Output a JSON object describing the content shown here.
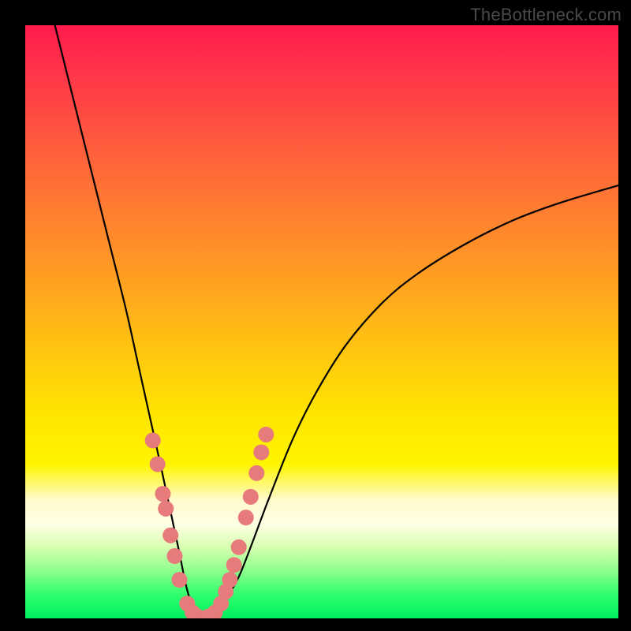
{
  "watermark": "TheBottleneck.com",
  "colors": {
    "curve_stroke": "#000000",
    "dot_fill": "#e77a7a",
    "dot_stroke": "#c75a5a"
  },
  "chart_data": {
    "type": "line",
    "title": "",
    "xlabel": "",
    "ylabel": "",
    "xlim": [
      0,
      100
    ],
    "ylim": [
      0,
      100
    ],
    "series": [
      {
        "name": "bottleneck-curve",
        "x": [
          5,
          8,
          11,
          14,
          17,
          19,
          21,
          23,
          24.5,
          26,
          27,
          28,
          29,
          30,
          31,
          32.5,
          34,
          36,
          38,
          41,
          45,
          49,
          54,
          60,
          66,
          74,
          82,
          90,
          100
        ],
        "y": [
          100,
          88,
          76,
          64,
          52,
          43,
          34,
          25,
          18,
          11,
          6,
          2.5,
          0.5,
          0,
          0.5,
          1.5,
          3.5,
          7,
          12,
          20,
          30,
          38,
          46,
          53,
          58,
          63,
          67,
          70,
          73
        ]
      }
    ],
    "dots": {
      "name": "highlighted-points",
      "points_xy": [
        [
          21.5,
          30
        ],
        [
          22.3,
          26
        ],
        [
          23.2,
          21
        ],
        [
          23.7,
          18.5
        ],
        [
          24.5,
          14
        ],
        [
          25.2,
          10.5
        ],
        [
          26.0,
          6.5
        ],
        [
          27.3,
          2.5
        ],
        [
          28.2,
          1.0
        ],
        [
          29.0,
          0.3
        ],
        [
          30.0,
          0.0
        ],
        [
          30.9,
          0.3
        ],
        [
          32.0,
          1.0
        ],
        [
          33.0,
          2.5
        ],
        [
          33.8,
          4.5
        ],
        [
          34.5,
          6.5
        ],
        [
          35.2,
          9.0
        ],
        [
          36.0,
          12.0
        ],
        [
          37.2,
          17.0
        ],
        [
          38.0,
          20.5
        ],
        [
          39.0,
          24.5
        ],
        [
          39.8,
          28.0
        ],
        [
          40.6,
          31.0
        ]
      ]
    }
  }
}
